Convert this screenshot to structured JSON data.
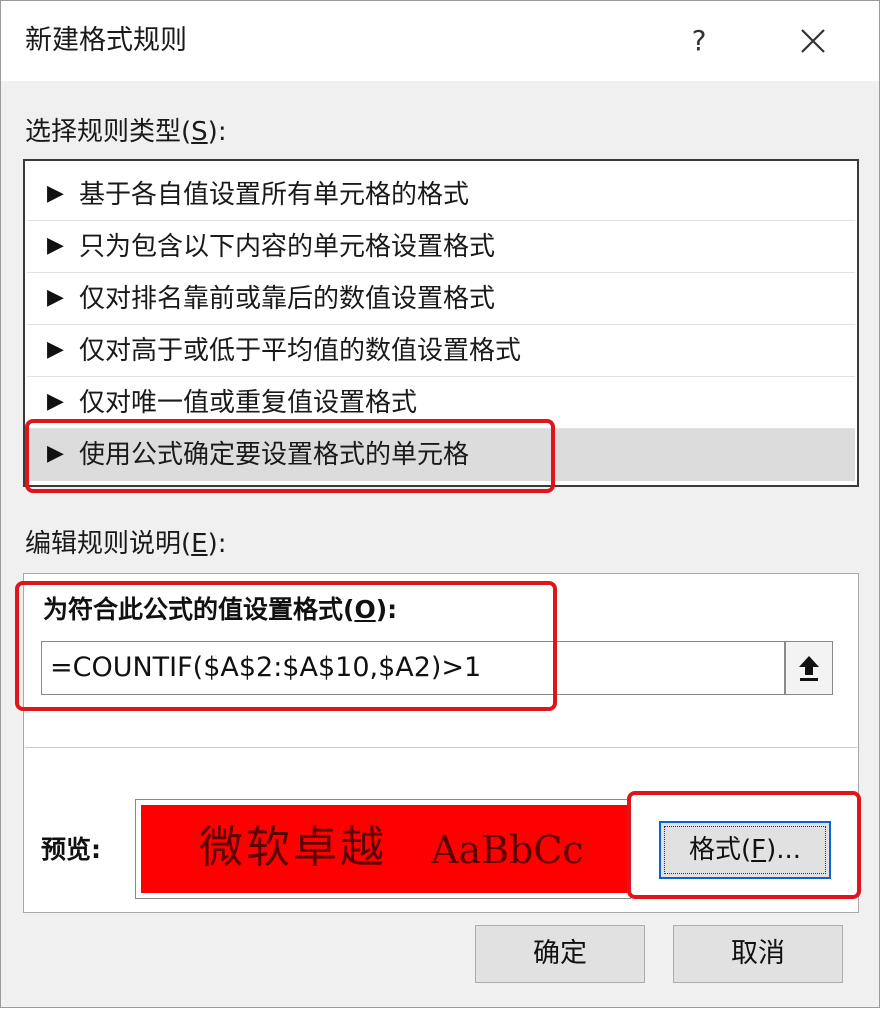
{
  "dialog": {
    "title": "新建格式规则",
    "help_label": "?",
    "close_icon": "close-icon"
  },
  "rule_type_section": {
    "label_prefix": "选择规则类型(",
    "label_key": "S",
    "label_suffix": "):",
    "items": [
      {
        "arrow": "▶",
        "label": "基于各自值设置所有单元格的格式"
      },
      {
        "arrow": "▶",
        "label": "只为包含以下内容的单元格设置格式"
      },
      {
        "arrow": "▶",
        "label": "仅对排名靠前或靠后的数值设置格式"
      },
      {
        "arrow": "▶",
        "label": "仅对高于或低于平均值的数值设置格式"
      },
      {
        "arrow": "▶",
        "label": "仅对唯一值或重复值设置格式"
      },
      {
        "arrow": "▶",
        "label": "使用公式确定要设置格式的单元格",
        "selected": true
      }
    ]
  },
  "edit_section": {
    "label_prefix": "编辑规则说明(",
    "label_key": "E",
    "label_suffix": "):",
    "formula_heading_prefix": "为符合此公式的值设置格式(",
    "formula_heading_key": "O",
    "formula_heading_suffix": "):",
    "formula_value": "=COUNTIF($A$2:$A$10,$A2)>1",
    "collapse_icon": "upload-arrow-icon",
    "preview_label": "预览:",
    "preview_text_cn": "微软卓越",
    "preview_text_en": "AaBbCc",
    "preview_fill_color": "#ff0000",
    "preview_text_color": "#5a0000",
    "format_button_prefix": "格式(",
    "format_button_key": "F",
    "format_button_suffix": ")..."
  },
  "footer": {
    "ok_label": "确定",
    "cancel_label": "取消"
  },
  "annotation_color": "#e0151c"
}
